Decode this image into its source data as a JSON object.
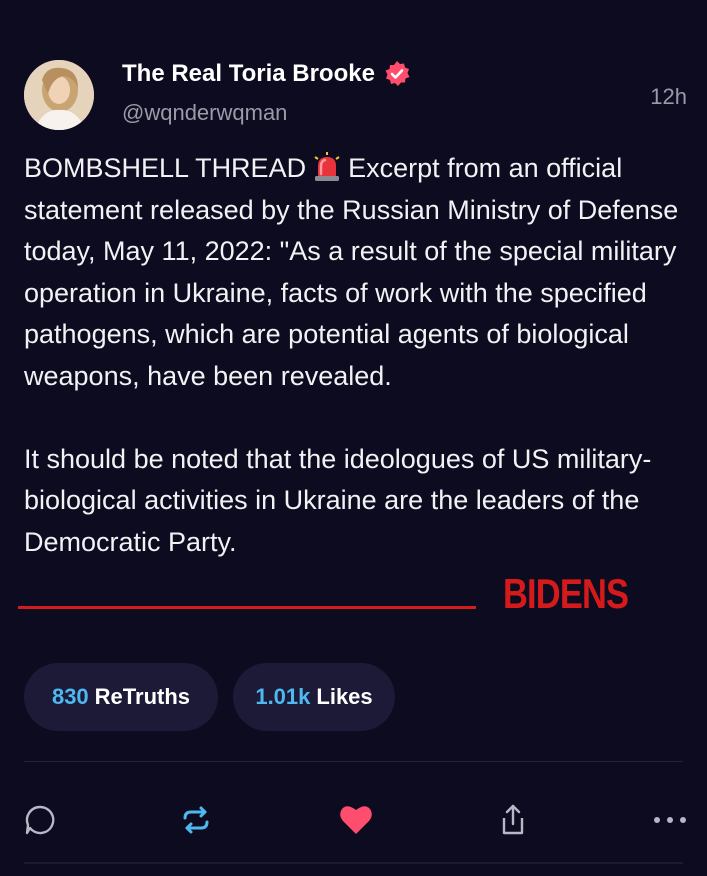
{
  "author": {
    "display_name": "The Real Toria Brooke",
    "handle": "@wqnderwqman",
    "verified": true
  },
  "timestamp": "12h",
  "post": {
    "paragraph1_start": "BOMBSHELL THREAD",
    "paragraph1_emoji": "police-light-siren",
    "paragraph1_rest": "Excerpt from an official statement released by the Russian Ministry of Defense today, May 11, 2022: \"As a result of the special military operation in Ukraine, facts of work with the specified pathogens, which are potential agents of biological weapons, have been revealed.",
    "paragraph2": "It should be noted that the ideologues of US military-biological activities in Ukraine are the leaders of the Democratic Party."
  },
  "annotation": {
    "text": "BIDENS",
    "color": "#d41a1a"
  },
  "stats": {
    "retruths_count": "830",
    "retruths_label": "ReTruths",
    "likes_count": "1.01k",
    "likes_label": "Likes"
  },
  "actions": {
    "icons": [
      "reply-icon",
      "retruth-icon",
      "like-icon",
      "share-icon",
      "more-icon"
    ]
  },
  "colors": {
    "background": "#0d0b1f",
    "accent_count": "#4fb8f0",
    "verified_badge": "#ff4d6d",
    "like_heart": "#ff4d6d",
    "retruth_icon": "#4fb8f0",
    "muted_text": "#9b9aa8"
  }
}
